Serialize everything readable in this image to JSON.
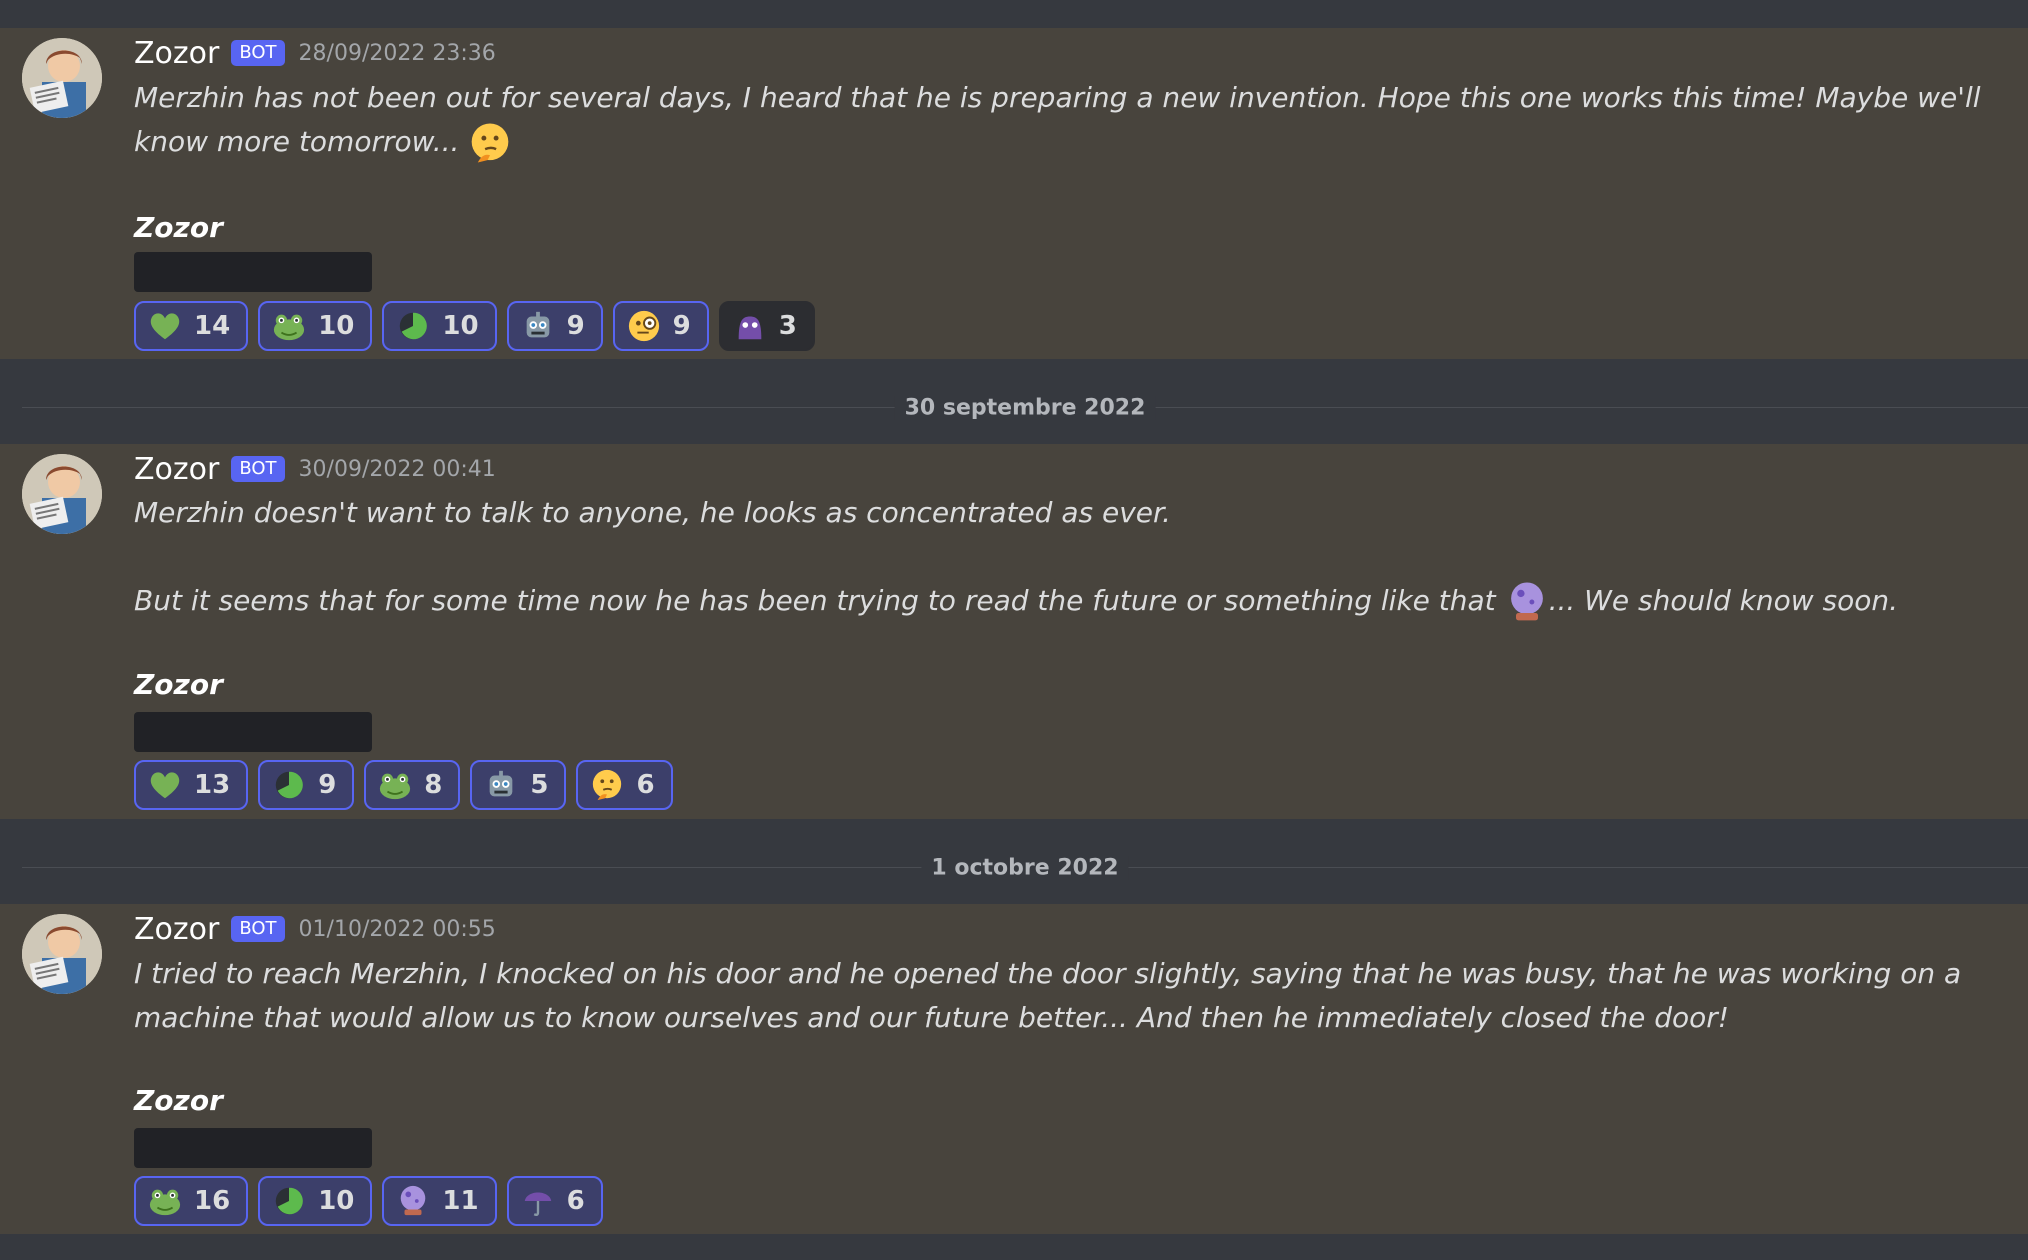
{
  "dividers": [
    {
      "label": "30 septembre 2022"
    },
    {
      "label": "1 octobre 2022"
    }
  ],
  "messages": [
    {
      "author": "Zozor",
      "badge": "BOT",
      "timestamp": "28/09/2022 23:36",
      "text_a": "Merzhin has not been out for several days, I heard that he is preparing a new invention. Hope this one works this time! Maybe we'll know more tomorrow...",
      "signature": "Zozor",
      "reactions": [
        {
          "emoji": "green-heart-icon",
          "count": "14"
        },
        {
          "emoji": "frog-icon",
          "count": "10"
        },
        {
          "emoji": "green-pie-icon",
          "count": "10"
        },
        {
          "emoji": "robot-icon",
          "count": "9"
        },
        {
          "emoji": "monocle-face-icon",
          "count": "9"
        },
        {
          "emoji": "purple-ghost-icon",
          "count": "3"
        }
      ]
    },
    {
      "author": "Zozor",
      "badge": "BOT",
      "timestamp": "30/09/2022 00:41",
      "text_a": "Merzhin doesn't want to talk to anyone, he looks as concentrated as ever.",
      "text_b": "But it seems that for some time now he has been trying to read the future or something like that",
      "text_c": "... We should know soon.",
      "signature": "Zozor",
      "reactions": [
        {
          "emoji": "green-heart-icon",
          "count": "13"
        },
        {
          "emoji": "green-pie-icon",
          "count": "9"
        },
        {
          "emoji": "frog-icon",
          "count": "8"
        },
        {
          "emoji": "robot-icon",
          "count": "5"
        },
        {
          "emoji": "thinking-face-icon",
          "count": "6"
        }
      ]
    },
    {
      "author": "Zozor",
      "badge": "BOT",
      "timestamp": "01/10/2022 00:55",
      "text_a": "I tried to reach Merzhin, I knocked on his door and he opened the door slightly, saying that he was busy, that he was working on a machine that would allow us to know ourselves and our future better... And then he immediately closed the door!",
      "signature": "Zozor",
      "reactions": [
        {
          "emoji": "frog-icon",
          "count": "16"
        },
        {
          "emoji": "green-pie-icon",
          "count": "10"
        },
        {
          "emoji": "crystal-ball-icon",
          "count": "11"
        },
        {
          "emoji": "purple-umbrella-icon",
          "count": "6"
        }
      ]
    }
  ],
  "colors": {
    "accent": "#5865f2",
    "message_bg": "#48443d",
    "page_bg": "#36393f"
  }
}
